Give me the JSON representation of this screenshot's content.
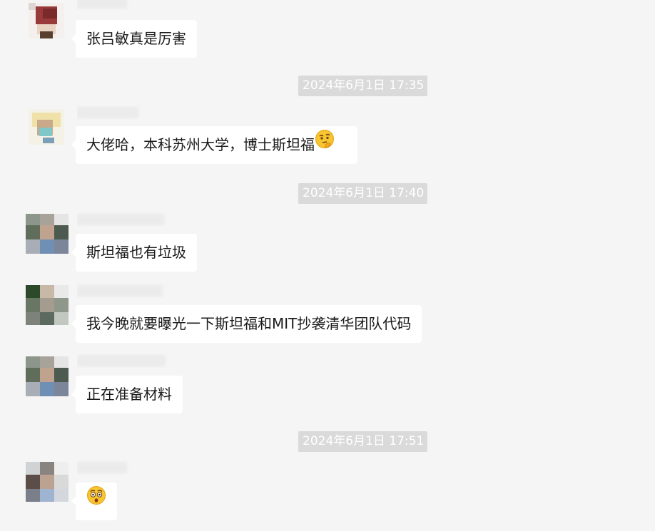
{
  "chat": {
    "messages": [
      {
        "text": "张吕敏真是厉害"
      },
      {
        "text": "大佬哈，本科苏州大学，博士斯坦福"
      },
      {
        "text": "斯坦福也有垃圾"
      },
      {
        "text": "我今晚就要曝光一下斯坦福和MIT抄袭清华团队代码"
      },
      {
        "text": "正在准备材料"
      },
      {
        "text": ""
      }
    ],
    "timestamps": [
      "2024年6月1日 17:35",
      "2024年6月1日 17:40",
      "2024年6月1日 17:51"
    ],
    "emojis": [
      "thinking-face-icon",
      "astonished-face-icon"
    ]
  },
  "colors": {
    "background": "#f5f5f5",
    "bubble": "#ffffff",
    "timestamp_bg": "#dadada",
    "timestamp_text": "#ffffff"
  }
}
